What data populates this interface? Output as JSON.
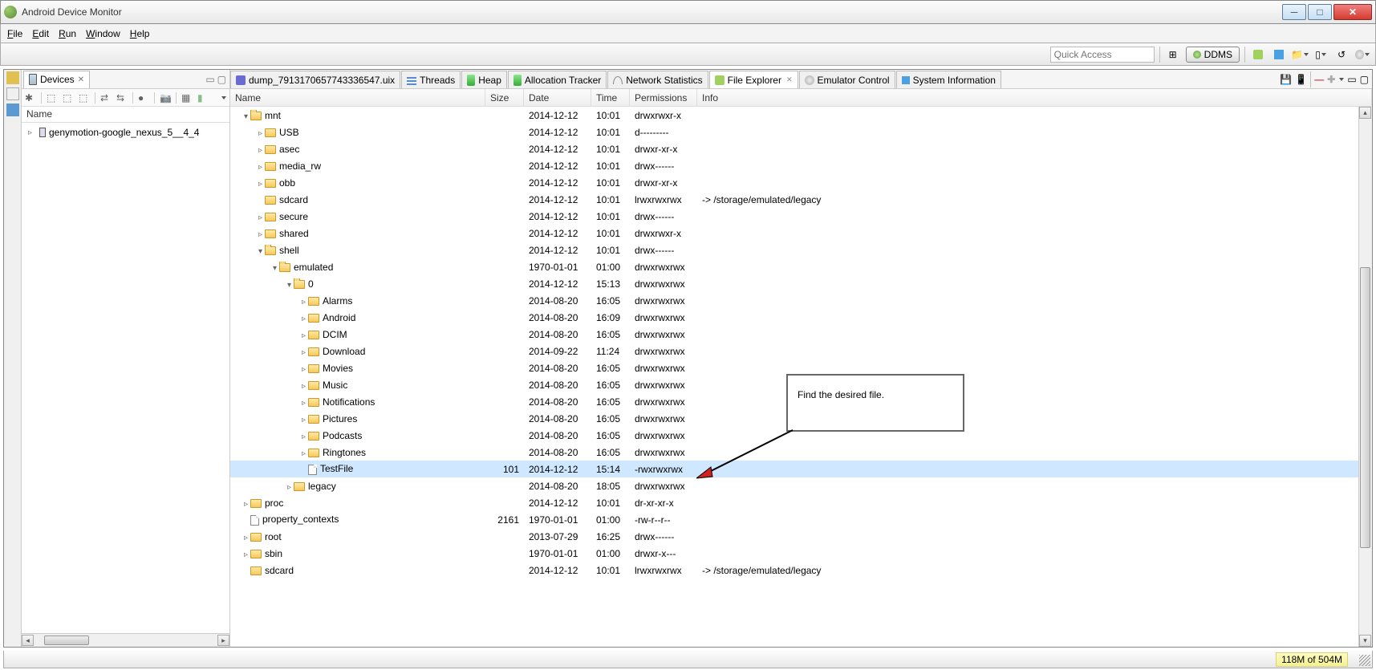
{
  "window": {
    "title": "Android Device Monitor"
  },
  "menu": {
    "file": "File",
    "edit": "Edit",
    "run": "Run",
    "window": "Window",
    "help": "Help"
  },
  "toolbar": {
    "quick_access_placeholder": "Quick Access",
    "perspective_label": "DDMS"
  },
  "devices_panel": {
    "title": "Devices",
    "column": "Name",
    "device": "genymotion-google_nexus_5__4_4"
  },
  "views": {
    "dump": "dump_7913170657743336547.uix",
    "threads": "Threads",
    "heap": "Heap",
    "alloc": "Allocation Tracker",
    "netstat": "Network Statistics",
    "file_explorer": "File Explorer",
    "emu_ctrl": "Emulator Control",
    "sysinfo": "System Information"
  },
  "columns": {
    "name": "Name",
    "size": "Size",
    "date": "Date",
    "time": "Time",
    "permissions": "Permissions",
    "info": "Info"
  },
  "files": [
    {
      "indent": 0,
      "exp": "▾",
      "icon": "folder-open",
      "name": "mnt",
      "size": "",
      "date": "2014-12-12",
      "time": "10:01",
      "perm": "drwxrwxr-x",
      "info": ""
    },
    {
      "indent": 1,
      "exp": "▹",
      "icon": "folder",
      "name": "USB",
      "size": "",
      "date": "2014-12-12",
      "time": "10:01",
      "perm": "d---------",
      "info": ""
    },
    {
      "indent": 1,
      "exp": "▹",
      "icon": "folder",
      "name": "asec",
      "size": "",
      "date": "2014-12-12",
      "time": "10:01",
      "perm": "drwxr-xr-x",
      "info": ""
    },
    {
      "indent": 1,
      "exp": "▹",
      "icon": "folder",
      "name": "media_rw",
      "size": "",
      "date": "2014-12-12",
      "time": "10:01",
      "perm": "drwx------",
      "info": ""
    },
    {
      "indent": 1,
      "exp": "▹",
      "icon": "folder",
      "name": "obb",
      "size": "",
      "date": "2014-12-12",
      "time": "10:01",
      "perm": "drwxr-xr-x",
      "info": ""
    },
    {
      "indent": 1,
      "exp": "",
      "icon": "folder",
      "name": "sdcard",
      "size": "",
      "date": "2014-12-12",
      "time": "10:01",
      "perm": "lrwxrwxrwx",
      "info": "-> /storage/emulated/legacy"
    },
    {
      "indent": 1,
      "exp": "▹",
      "icon": "folder",
      "name": "secure",
      "size": "",
      "date": "2014-12-12",
      "time": "10:01",
      "perm": "drwx------",
      "info": ""
    },
    {
      "indent": 1,
      "exp": "▹",
      "icon": "folder",
      "name": "shared",
      "size": "",
      "date": "2014-12-12",
      "time": "10:01",
      "perm": "drwxrwxr-x",
      "info": ""
    },
    {
      "indent": 1,
      "exp": "▾",
      "icon": "folder-open",
      "name": "shell",
      "size": "",
      "date": "2014-12-12",
      "time": "10:01",
      "perm": "drwx------",
      "info": ""
    },
    {
      "indent": 2,
      "exp": "▾",
      "icon": "folder-open",
      "name": "emulated",
      "size": "",
      "date": "1970-01-01",
      "time": "01:00",
      "perm": "drwxrwxrwx",
      "info": ""
    },
    {
      "indent": 3,
      "exp": "▾",
      "icon": "folder-open",
      "name": "0",
      "size": "",
      "date": "2014-12-12",
      "time": "15:13",
      "perm": "drwxrwxrwx",
      "info": ""
    },
    {
      "indent": 4,
      "exp": "▹",
      "icon": "folder",
      "name": "Alarms",
      "size": "",
      "date": "2014-08-20",
      "time": "16:05",
      "perm": "drwxrwxrwx",
      "info": ""
    },
    {
      "indent": 4,
      "exp": "▹",
      "icon": "folder",
      "name": "Android",
      "size": "",
      "date": "2014-08-20",
      "time": "16:09",
      "perm": "drwxrwxrwx",
      "info": ""
    },
    {
      "indent": 4,
      "exp": "▹",
      "icon": "folder",
      "name": "DCIM",
      "size": "",
      "date": "2014-08-20",
      "time": "16:05",
      "perm": "drwxrwxrwx",
      "info": ""
    },
    {
      "indent": 4,
      "exp": "▹",
      "icon": "folder",
      "name": "Download",
      "size": "",
      "date": "2014-09-22",
      "time": "11:24",
      "perm": "drwxrwxrwx",
      "info": ""
    },
    {
      "indent": 4,
      "exp": "▹",
      "icon": "folder",
      "name": "Movies",
      "size": "",
      "date": "2014-08-20",
      "time": "16:05",
      "perm": "drwxrwxrwx",
      "info": ""
    },
    {
      "indent": 4,
      "exp": "▹",
      "icon": "folder",
      "name": "Music",
      "size": "",
      "date": "2014-08-20",
      "time": "16:05",
      "perm": "drwxrwxrwx",
      "info": ""
    },
    {
      "indent": 4,
      "exp": "▹",
      "icon": "folder",
      "name": "Notifications",
      "size": "",
      "date": "2014-08-20",
      "time": "16:05",
      "perm": "drwxrwxrwx",
      "info": ""
    },
    {
      "indent": 4,
      "exp": "▹",
      "icon": "folder",
      "name": "Pictures",
      "size": "",
      "date": "2014-08-20",
      "time": "16:05",
      "perm": "drwxrwxrwx",
      "info": ""
    },
    {
      "indent": 4,
      "exp": "▹",
      "icon": "folder",
      "name": "Podcasts",
      "size": "",
      "date": "2014-08-20",
      "time": "16:05",
      "perm": "drwxrwxrwx",
      "info": ""
    },
    {
      "indent": 4,
      "exp": "▹",
      "icon": "folder",
      "name": "Ringtones",
      "size": "",
      "date": "2014-08-20",
      "time": "16:05",
      "perm": "drwxrwxrwx",
      "info": ""
    },
    {
      "indent": 4,
      "exp": "",
      "icon": "file",
      "name": "TestFile",
      "size": "101",
      "date": "2014-12-12",
      "time": "15:14",
      "perm": "-rwxrwxrwx",
      "info": "",
      "selected": true
    },
    {
      "indent": 3,
      "exp": "▹",
      "icon": "folder",
      "name": "legacy",
      "size": "",
      "date": "2014-08-20",
      "time": "18:05",
      "perm": "drwxrwxrwx",
      "info": ""
    },
    {
      "indent": 0,
      "exp": "▹",
      "icon": "folder",
      "name": "proc",
      "size": "",
      "date": "2014-12-12",
      "time": "10:01",
      "perm": "dr-xr-xr-x",
      "info": ""
    },
    {
      "indent": 0,
      "exp": "",
      "icon": "file",
      "name": "property_contexts",
      "size": "2161",
      "date": "1970-01-01",
      "time": "01:00",
      "perm": "-rw-r--r--",
      "info": ""
    },
    {
      "indent": 0,
      "exp": "▹",
      "icon": "folder",
      "name": "root",
      "size": "",
      "date": "2013-07-29",
      "time": "16:25",
      "perm": "drwx------",
      "info": ""
    },
    {
      "indent": 0,
      "exp": "▹",
      "icon": "folder",
      "name": "sbin",
      "size": "",
      "date": "1970-01-01",
      "time": "01:00",
      "perm": "drwxr-x---",
      "info": ""
    },
    {
      "indent": 0,
      "exp": "",
      "icon": "folder",
      "name": "sdcard",
      "size": "",
      "date": "2014-12-12",
      "time": "10:01",
      "perm": "lrwxrwxrwx",
      "info": "-> /storage/emulated/legacy"
    }
  ],
  "status": {
    "memory": "118M of 504M"
  },
  "annotation": {
    "text": "Find the desired file."
  }
}
